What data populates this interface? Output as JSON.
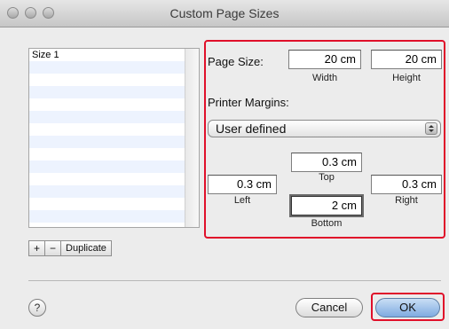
{
  "window": {
    "title": "Custom Page Sizes"
  },
  "sizes_list": {
    "items": [
      "Size 1"
    ]
  },
  "list_buttons": {
    "add": "+",
    "remove": "−",
    "duplicate": "Duplicate"
  },
  "page_size": {
    "label": "Page Size:",
    "width_value": "20 cm",
    "height_value": "20 cm",
    "width_caption": "Width",
    "height_caption": "Height"
  },
  "margins": {
    "label": "Printer Margins:",
    "preset": "User defined",
    "top_value": "0.3 cm",
    "left_value": "0.3 cm",
    "right_value": "0.3 cm",
    "bottom_value": "2 cm",
    "top_caption": "Top",
    "left_caption": "Left",
    "right_caption": "Right",
    "bottom_caption": "Bottom"
  },
  "footer": {
    "help": "?",
    "cancel": "Cancel",
    "ok": "OK"
  },
  "colors": {
    "highlight": "#e0102a",
    "default_button": "#7fabe1",
    "list_stripe": "#edf3fe"
  }
}
